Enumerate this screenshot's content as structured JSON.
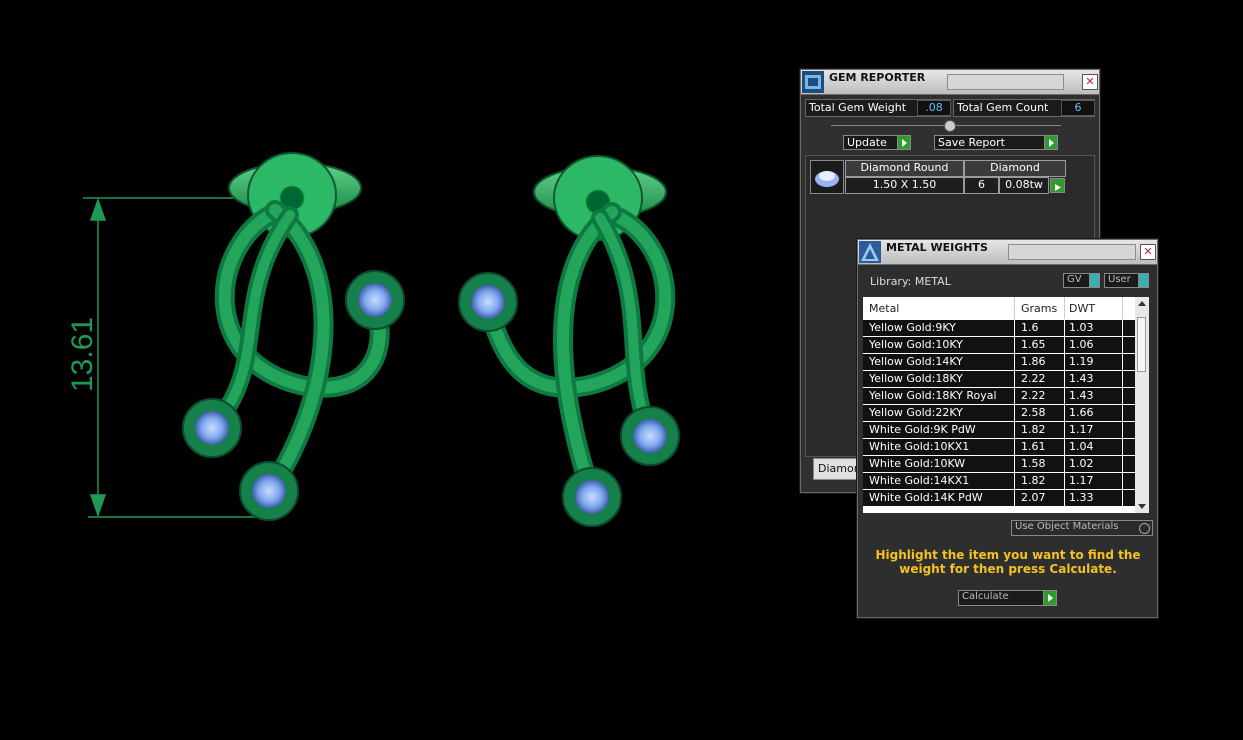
{
  "dimension": {
    "value": "13.61"
  },
  "gem_reporter": {
    "title": "GEM REPORTER",
    "total_weight_label": "Total Gem Weight",
    "total_weight_value": ".08",
    "total_count_label": "Total Gem Count",
    "total_count_value": "6",
    "update_label": "Update",
    "save_report_label": "Save Report",
    "gem": {
      "name": "Diamond Round",
      "material": "Diamond",
      "size": "1.50 X 1.50",
      "count": "6",
      "weight": "0.08tw"
    },
    "bottom_tab_label": "Diamonc"
  },
  "metal_weights": {
    "title": "METAL WEIGHTS",
    "library_label": "Library: METAL",
    "gv_label": "GV",
    "user_label": "User",
    "columns": [
      "Metal",
      "Grams",
      "DWT"
    ],
    "rows": [
      [
        "Yellow Gold:9KY",
        "1.6",
        "1.03"
      ],
      [
        "Yellow Gold:10KY",
        "1.65",
        "1.06"
      ],
      [
        "Yellow Gold:14KY",
        "1.86",
        "1.19"
      ],
      [
        "Yellow Gold:18KY",
        "2.22",
        "1.43"
      ],
      [
        "Yellow Gold:18KY Royal",
        "2.22",
        "1.43"
      ],
      [
        "Yellow Gold:22KY",
        "2.58",
        "1.66"
      ],
      [
        "White Gold:9K PdW",
        "1.82",
        "1.17"
      ],
      [
        "White Gold:10KX1",
        "1.61",
        "1.04"
      ],
      [
        "White Gold:10KW",
        "1.58",
        "1.02"
      ],
      [
        "White Gold:14KX1",
        "1.82",
        "1.17"
      ],
      [
        "White Gold:14K PdW",
        "2.07",
        "1.33"
      ]
    ],
    "use_object_materials_label": "Use Object Materials",
    "instruction": "Highlight the item you want to find the weight for then press Calculate.",
    "calculate_label": "Calculate"
  }
}
